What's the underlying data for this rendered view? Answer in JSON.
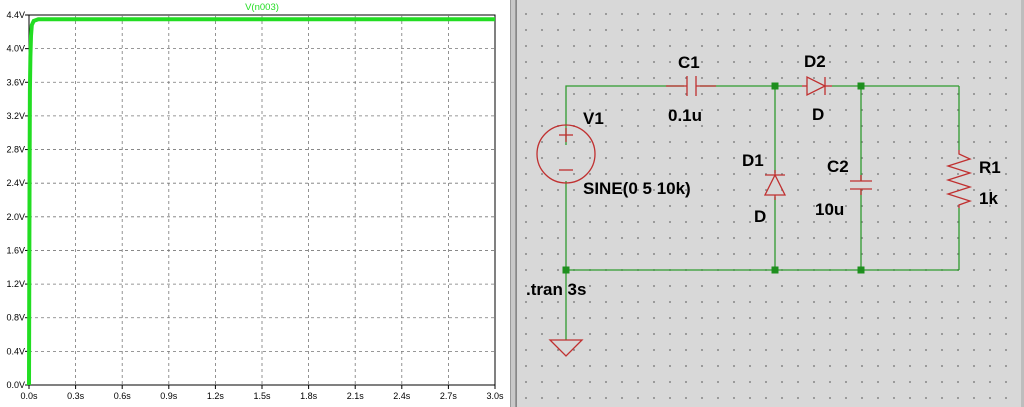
{
  "plot": {
    "trace_label": "V(n003)",
    "trace_color": "#22dd22",
    "y_ticks": [
      "0.0V",
      "0.4V",
      "0.8V",
      "1.2V",
      "1.6V",
      "2.0V",
      "2.4V",
      "2.8V",
      "3.2V",
      "3.6V",
      "4.0V",
      "4.4V"
    ],
    "x_ticks": [
      "0.0s",
      "0.3s",
      "0.6s",
      "0.9s",
      "1.2s",
      "1.5s",
      "1.8s",
      "2.1s",
      "2.4s",
      "2.7s",
      "3.0s"
    ],
    "y_range": [
      0,
      4.4
    ],
    "x_range": [
      0,
      3.0
    ],
    "steady_value": 4.35
  },
  "schematic": {
    "wire_color": "#2f9a2f",
    "component_color": "#c03030",
    "v1": {
      "name": "V1",
      "value": "SINE(0 5 10k)"
    },
    "c1": {
      "name": "C1",
      "value": "0.1u"
    },
    "d1": {
      "name": "D1",
      "value": "D"
    },
    "d2": {
      "name": "D2",
      "value": "D"
    },
    "c2": {
      "name": "C2",
      "value": "10u"
    },
    "r1": {
      "name": "R1",
      "value": "1k"
    },
    "directive": ".tran 3s"
  }
}
